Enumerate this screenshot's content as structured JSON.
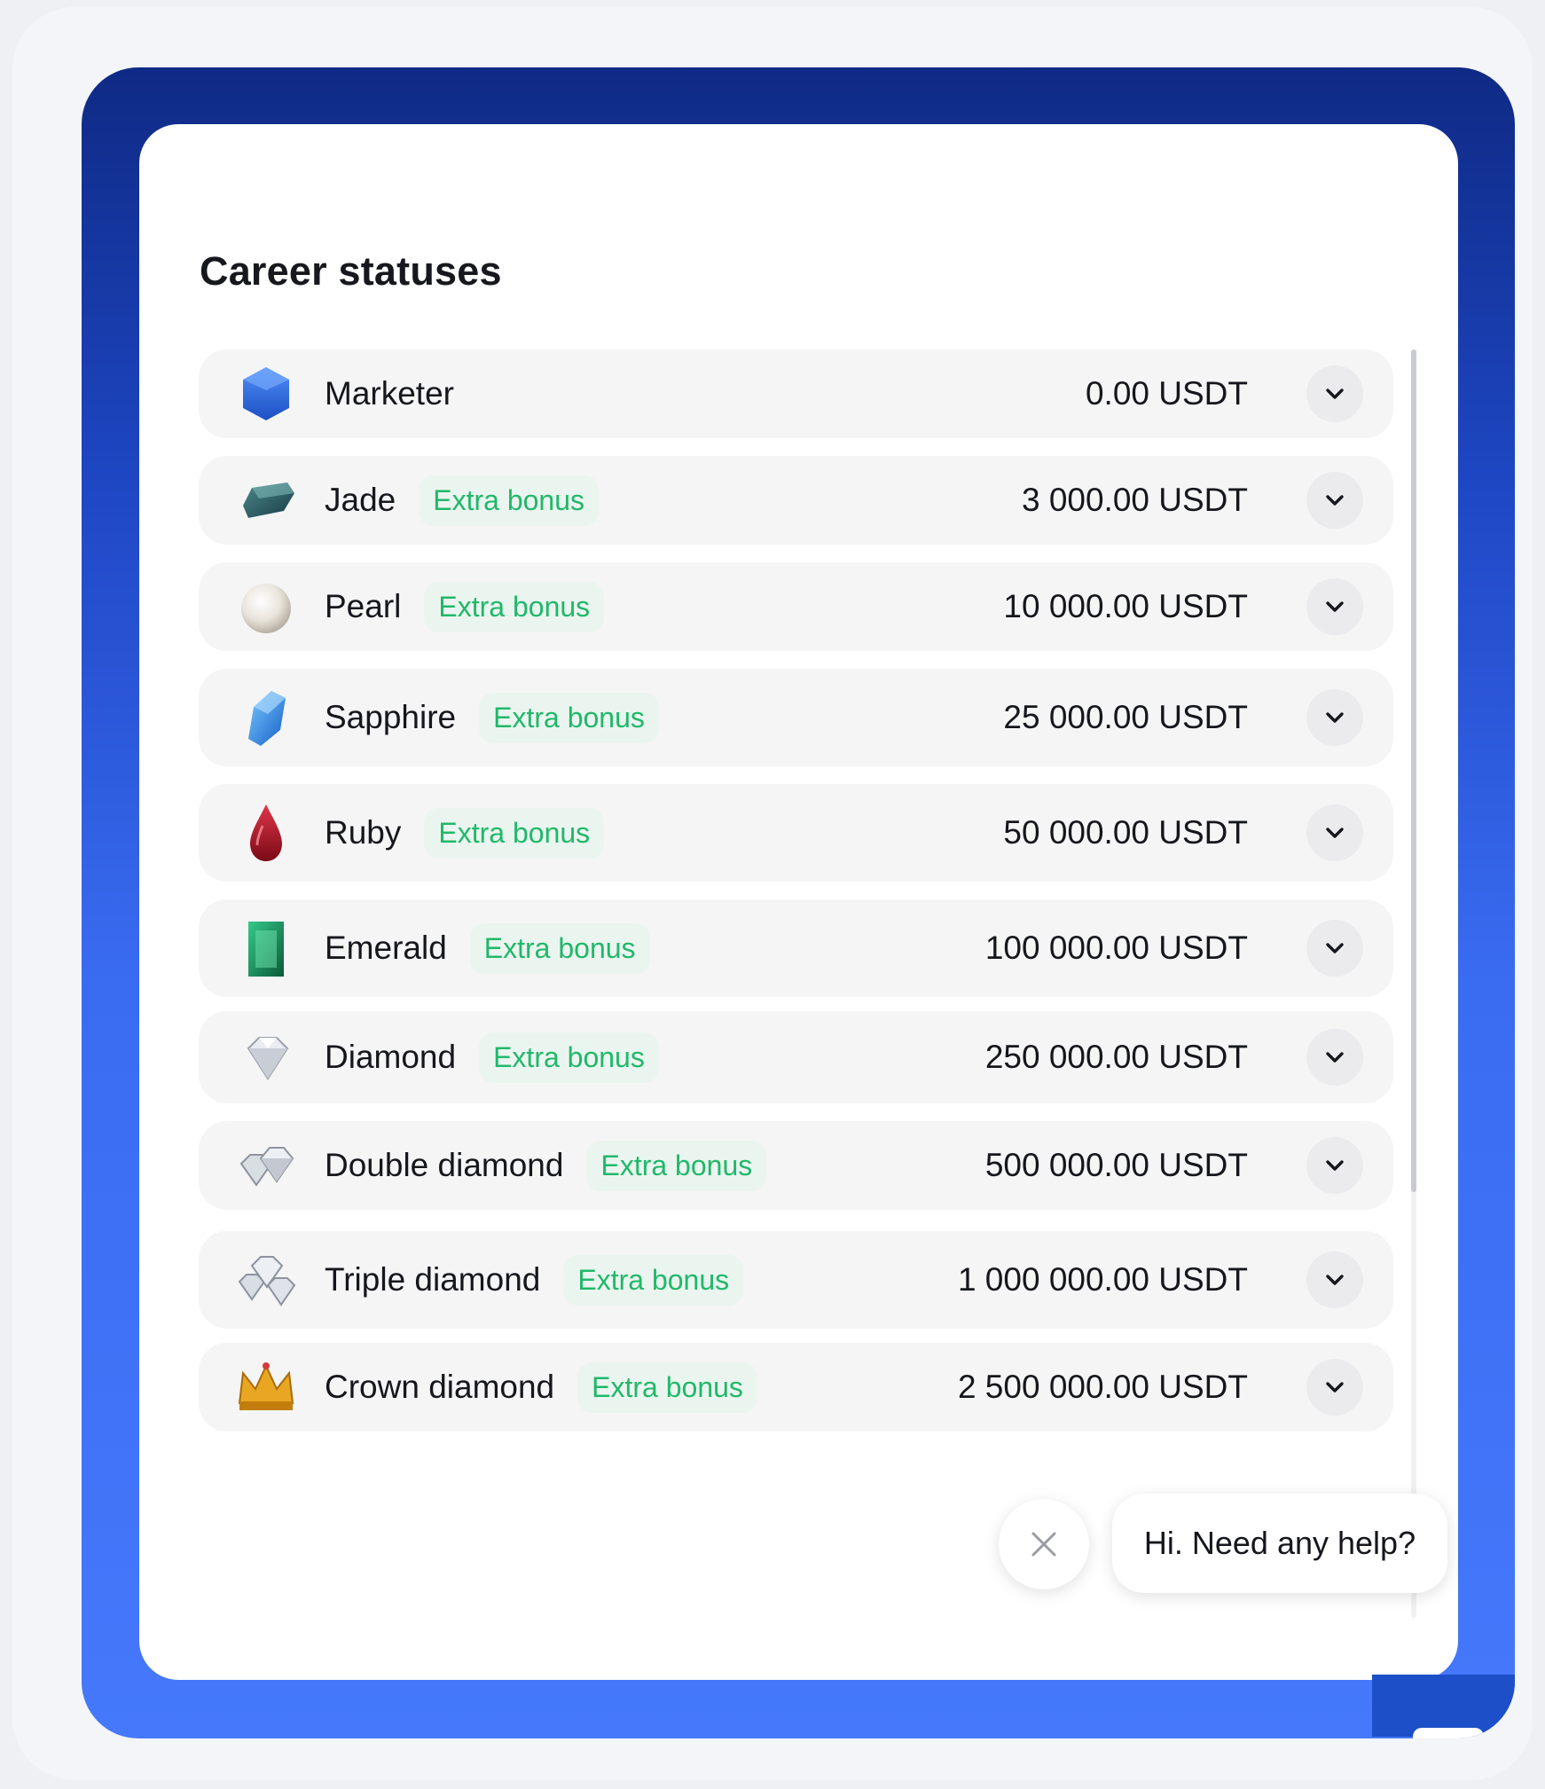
{
  "panel": {
    "title": "Career statuses"
  },
  "statuses": [
    {
      "name": "Marketer",
      "badge": "",
      "amount": "0.00 USDT",
      "icon": "blue-hexagon-gem-icon"
    },
    {
      "name": "Jade",
      "badge": "Extra bonus",
      "amount": "3 000.00 USDT",
      "icon": "jade-gem-icon"
    },
    {
      "name": "Pearl",
      "badge": "Extra bonus",
      "amount": "10 000.00 USDT",
      "icon": "pearl-icon"
    },
    {
      "name": "Sapphire",
      "badge": "Extra bonus",
      "amount": "25 000.00 USDT",
      "icon": "sapphire-gem-icon"
    },
    {
      "name": "Ruby",
      "badge": "Extra bonus",
      "amount": "50 000.00 USDT",
      "icon": "ruby-gem-icon"
    },
    {
      "name": "Emerald",
      "badge": "Extra bonus",
      "amount": "100 000.00 USDT",
      "icon": "emerald-gem-icon"
    },
    {
      "name": "Diamond",
      "badge": "Extra bonus",
      "amount": "250 000.00 USDT",
      "icon": "diamond-icon"
    },
    {
      "name": "Double diamond",
      "badge": "Extra bonus",
      "amount": "500 000.00 USDT",
      "icon": "double-diamond-icon"
    },
    {
      "name": "Triple diamond",
      "badge": "Extra bonus",
      "amount": "1 000 000.00 USDT",
      "icon": "triple-diamond-icon"
    },
    {
      "name": "Crown diamond",
      "badge": "Extra bonus",
      "amount": "2 500 000.00 USDT",
      "icon": "crown-icon"
    }
  ],
  "chat": {
    "help_text": "Hi. Need any help?",
    "close_icon": "close-icon"
  },
  "colors": {
    "frame_top": "#0f2a85",
    "frame_bottom": "#4578fb",
    "badge_text": "#20b86a",
    "badge_bg": "#ebf5ef",
    "row_bg": "#f5f5f6"
  }
}
